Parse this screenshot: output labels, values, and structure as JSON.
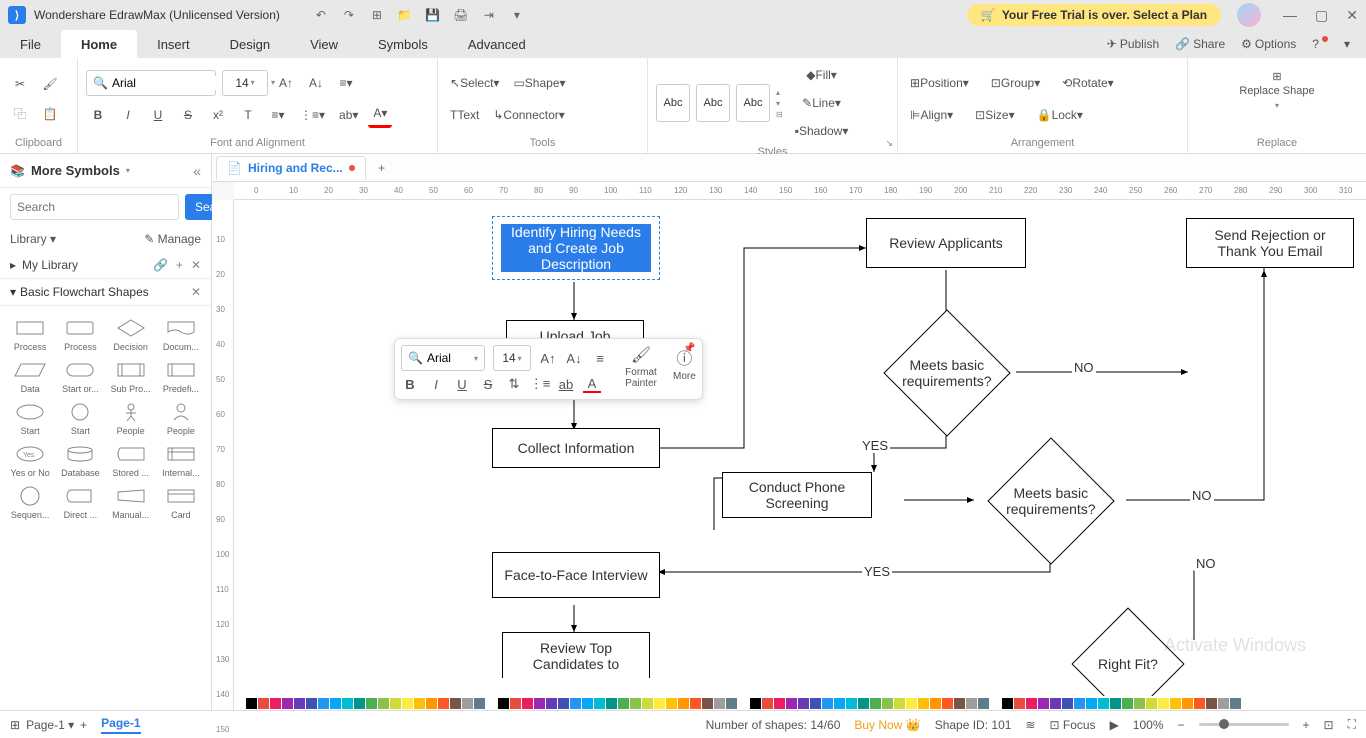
{
  "app": {
    "title": "Wondershare EdrawMax (Unlicensed Version)",
    "trial_text": "Your Free Trial is over. Select a Plan"
  },
  "menus": {
    "file": "File",
    "home": "Home",
    "insert": "Insert",
    "design": "Design",
    "view": "View",
    "symbols": "Symbols",
    "advanced": "Advanced",
    "publish": "Publish",
    "share": "Share",
    "options": "Options"
  },
  "ribbon": {
    "clipboard": {
      "label": "Clipboard"
    },
    "font": {
      "label": "Font and Alignment",
      "font_name": "Arial",
      "font_size": "14"
    },
    "tools": {
      "label": "Tools",
      "select": "Select",
      "shape": "Shape",
      "text": "Text",
      "connector": "Connector"
    },
    "styles": {
      "label": "Styles",
      "abc": "Abc",
      "fill": "Fill",
      "line": "Line",
      "shadow": "Shadow"
    },
    "arrangement": {
      "label": "Arrangement",
      "position": "Position",
      "align": "Align",
      "group": "Group",
      "size": "Size",
      "rotate": "Rotate",
      "lock": "Lock"
    },
    "replace": {
      "label": "Replace",
      "btn": "Replace Shape"
    }
  },
  "left_panel": {
    "more_symbols": "More Symbols",
    "search_placeholder": "Search",
    "search_btn": "Search",
    "library": "Library",
    "manage": "Manage",
    "my_library": "My Library",
    "section": "Basic Flowchart Shapes",
    "shapes": [
      "Process",
      "Process",
      "Decision",
      "Docum...",
      "Data",
      "Start or...",
      "Sub Pro...",
      "Predefi...",
      "Start",
      "Start",
      "People",
      "People",
      "Yes or No",
      "Database",
      "Stored ...",
      "Internal...",
      "Sequen...",
      "Direct ...",
      "Manual...",
      "Card"
    ]
  },
  "doc": {
    "tab_name": "Hiring and Rec...",
    "add": "+"
  },
  "canvas": {
    "nodes": {
      "n1": "Identify Hiring Needs and Create Job Description",
      "n2": "Upload Job",
      "n3": "Collect Information",
      "n4": "Review Applicants",
      "n5": "Meets basic requirements?",
      "n6": "Conduct Phone Screening",
      "n7": "Meets basic requirements?",
      "n8": "Face-to-Face Interview",
      "n9": "Review Top Candidates to",
      "n10": "Send Rejection or Thank You Email",
      "n11": "Right Fit?"
    },
    "labels": {
      "yes1": "YES",
      "no1": "NO",
      "yes2": "YES",
      "no2": "NO",
      "no3": "NO"
    }
  },
  "float_tb": {
    "font": "Arial",
    "size": "14",
    "format_painter": "Format Painter",
    "more": "More"
  },
  "status": {
    "page_label": "Page-1",
    "page_tab": "Page-1",
    "shapes_count": "Number of shapes: 14/60",
    "buy_now": "Buy Now",
    "shape_id": "Shape ID: 101",
    "focus": "Focus",
    "zoom": "100%"
  },
  "watermark": "Activate Windows"
}
